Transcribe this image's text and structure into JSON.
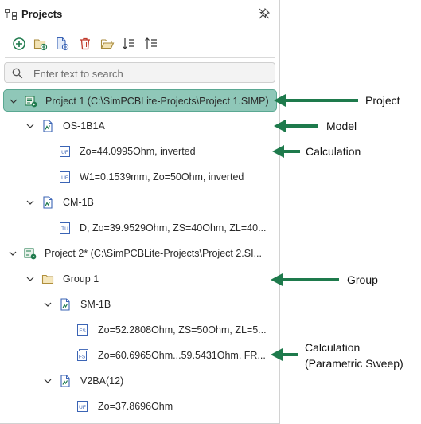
{
  "panel": {
    "title": "Projects",
    "toolbar": [
      "add-icon",
      "new-folder-icon",
      "new-file-icon",
      "delete-icon",
      "open-folder-icon",
      "sort-ascending-icon",
      "sort-descending-icon"
    ],
    "search": {
      "placeholder": "Enter text to search",
      "value": ""
    }
  },
  "tree": [
    {
      "label": "Project 1 (C:\\SimPCBLite-Projects\\Project 1.SIMP)",
      "icon": "project-icon",
      "expanded": true,
      "selected": true
    },
    {
      "label": "OS-1B1A",
      "icon": "model-icon",
      "expanded": true
    },
    {
      "label": "Zo=44.0995Ohm, inverted",
      "icon": "calculation-uf-icon",
      "badge": "UF"
    },
    {
      "label": "W1=0.1539mm, Zo=50Ohm, inverted",
      "icon": "calculation-uf-icon",
      "badge": "UF"
    },
    {
      "label": "CM-1B",
      "icon": "model-icon",
      "expanded": true
    },
    {
      "label": "D, Zo=39.9529Ohm, ZS=40Ohm, ZL=40...",
      "icon": "calculation-tu-icon",
      "badge": "TU"
    },
    {
      "label": "Project 2* (C:\\SimPCBLite-Projects\\Project 2.SI...",
      "icon": "project-icon",
      "expanded": true
    },
    {
      "label": "Group 1",
      "icon": "folder-icon",
      "expanded": true
    },
    {
      "label": "SM-1B",
      "icon": "model-icon",
      "expanded": true
    },
    {
      "label": "Zo=52.2808Ohm, ZS=50Ohm, ZL=5...",
      "icon": "calculation-fs-icon",
      "badge": "FS"
    },
    {
      "label": "Zo=60.6965Ohm...59.5431Ohm, FR...",
      "icon": "parametric-sweep-icon",
      "badge": "FS"
    },
    {
      "label": "V2BA(12)",
      "icon": "model-icon",
      "expanded": true
    },
    {
      "label": "Zo=37.8696Ohm",
      "icon": "calculation-uf-icon",
      "badge": "UF"
    }
  ],
  "annotations": {
    "project": "Project",
    "model": "Model",
    "calculation": "Calculation",
    "group": "Group",
    "sweep_line1": "Calculation",
    "sweep_line2": "(Parametric Sweep)"
  },
  "colors": {
    "accent": "#1e7a4c",
    "selection": "#8fc7b8",
    "icon_blue": "#3b64b5",
    "delete_red": "#c0392b",
    "folder": "#c9a24a"
  }
}
